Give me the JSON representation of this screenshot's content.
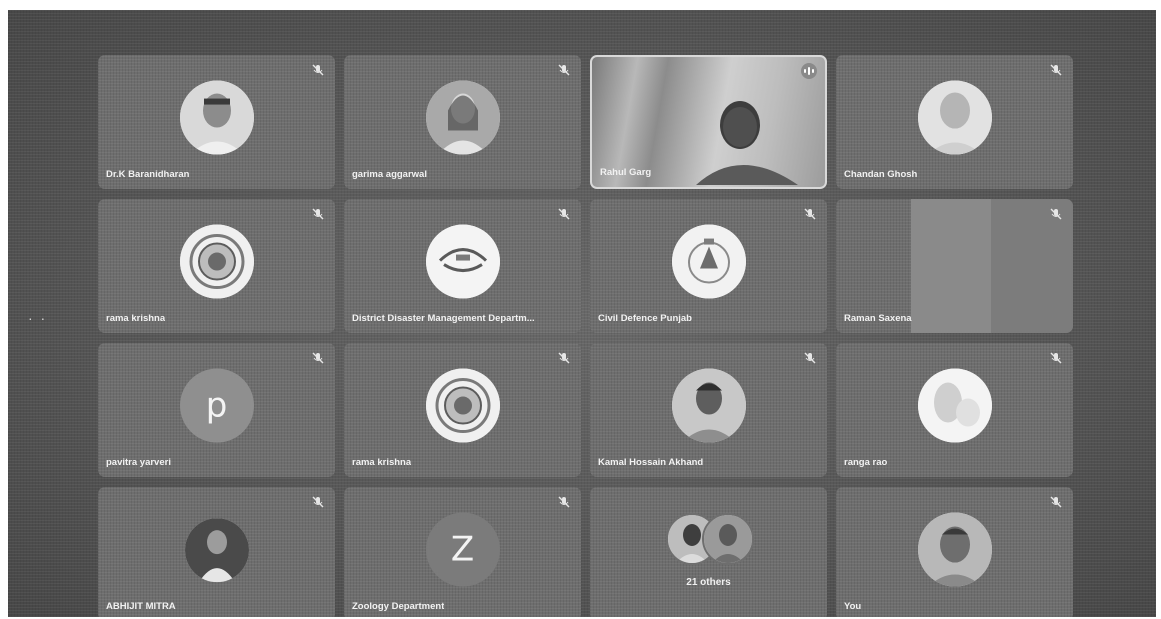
{
  "meeting": {
    "more_indicator": "· ·",
    "others_label": "21 others",
    "participants": [
      {
        "name": "Dr.K Baranidharan",
        "kind": "photo"
      },
      {
        "name": "garima aggarwal",
        "kind": "photo"
      },
      {
        "name": "Rahul Garg",
        "kind": "video"
      },
      {
        "name": "Chandan Ghosh",
        "kind": "photo"
      },
      {
        "name": "rama krishna",
        "kind": "emblem"
      },
      {
        "name": "District Disaster Management Departm...",
        "kind": "logo"
      },
      {
        "name": "Civil Defence Punjab",
        "kind": "emblem"
      },
      {
        "name": "Raman Saxena",
        "kind": "split"
      },
      {
        "name": "pavitra yarveri",
        "kind": "letter",
        "initial": "p"
      },
      {
        "name": "rama krishna",
        "kind": "emblem"
      },
      {
        "name": "Kamal Hossain Akhand",
        "kind": "photo"
      },
      {
        "name": "ranga rao",
        "kind": "photo"
      },
      {
        "name": "ABHIJIT MITRA",
        "kind": "photo"
      },
      {
        "name": "Zoology Department",
        "kind": "letter",
        "initial": "Z"
      },
      {
        "name": "",
        "kind": "group"
      },
      {
        "name": "You",
        "kind": "photo"
      }
    ]
  },
  "icons": {
    "muted": "mic-off-icon",
    "speaking": "audio-levels-icon",
    "more": "more-dots-icon"
  },
  "colors": {
    "background": "#5f5f5f",
    "tile": "#6e6e6e",
    "text": "#f2f2f2"
  }
}
